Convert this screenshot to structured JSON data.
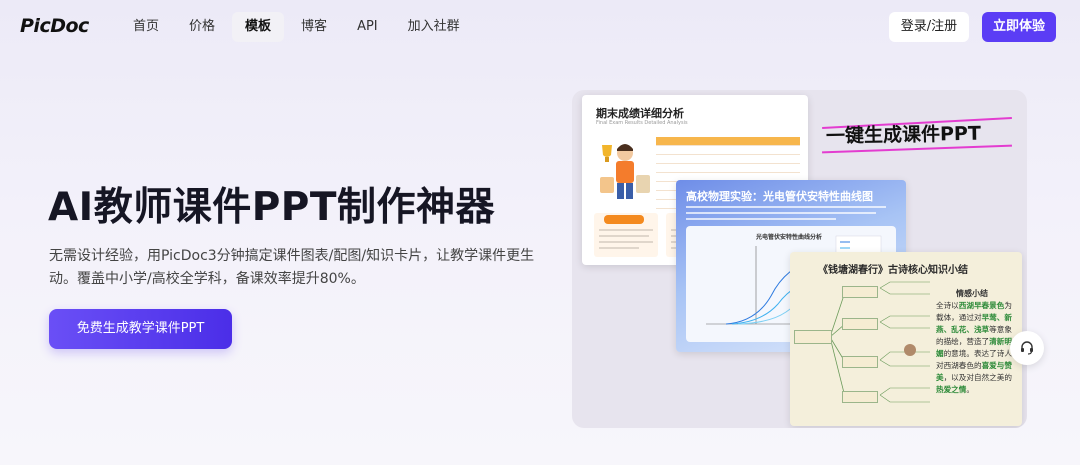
{
  "nav": {
    "logo": "PicDoc",
    "items": [
      {
        "label": "首页",
        "active": false
      },
      {
        "label": "价格",
        "active": false
      },
      {
        "label": "模板",
        "active": true
      },
      {
        "label": "博客",
        "active": false
      },
      {
        "label": "API",
        "active": false
      },
      {
        "label": "加入社群",
        "active": false
      }
    ],
    "login_label": "登录/注册",
    "try_label": "立即体验"
  },
  "hero": {
    "title": "AI教师课件PPT制作神器",
    "description": "无需设计经验，用PicDoc3分钟搞定课件图表/配图/知识卡片，让教学课件更生动。覆盖中小学/高校全学科，备课效率提升80%。",
    "cta_label": "免费生成教学课件PPT"
  },
  "showcase": {
    "tagline": "一键生成课件PPT",
    "card1": {
      "title": "期末成绩详细分析",
      "subtitle": "Final Exam Results Detailed Analysis"
    },
    "card2": {
      "title": "高校物理实验：光电管伏安特性曲线图",
      "plot_title": "光电管伏安特性曲线分析"
    },
    "card3": {
      "title": "《钱塘湖春行》古诗核心知识小结",
      "panel_heading": "情感小结",
      "panel_text_1": "全诗以",
      "panel_highlight_1": "西湖早春景色",
      "panel_text_2": "为载体，通过对",
      "panel_highlight_2": "早莺、新燕、乱花、浅草",
      "panel_text_3": "等意象的描绘，营造了",
      "panel_highlight_3": "清新明媚",
      "panel_text_4": "的意境。表达了诗人对西湖春色的",
      "panel_highlight_4": "喜爱与赞美",
      "panel_text_5": "，以及对自然之美的",
      "panel_highlight_5": "热爱之情",
      "panel_text_6": "。"
    }
  },
  "colors": {
    "brand": "#5b3df5",
    "accent_orange": "#f48a1f",
    "accent_pink": "#e33cd0",
    "green_highlight": "#2e8b3a"
  },
  "icons": {
    "support": "headset-icon"
  }
}
